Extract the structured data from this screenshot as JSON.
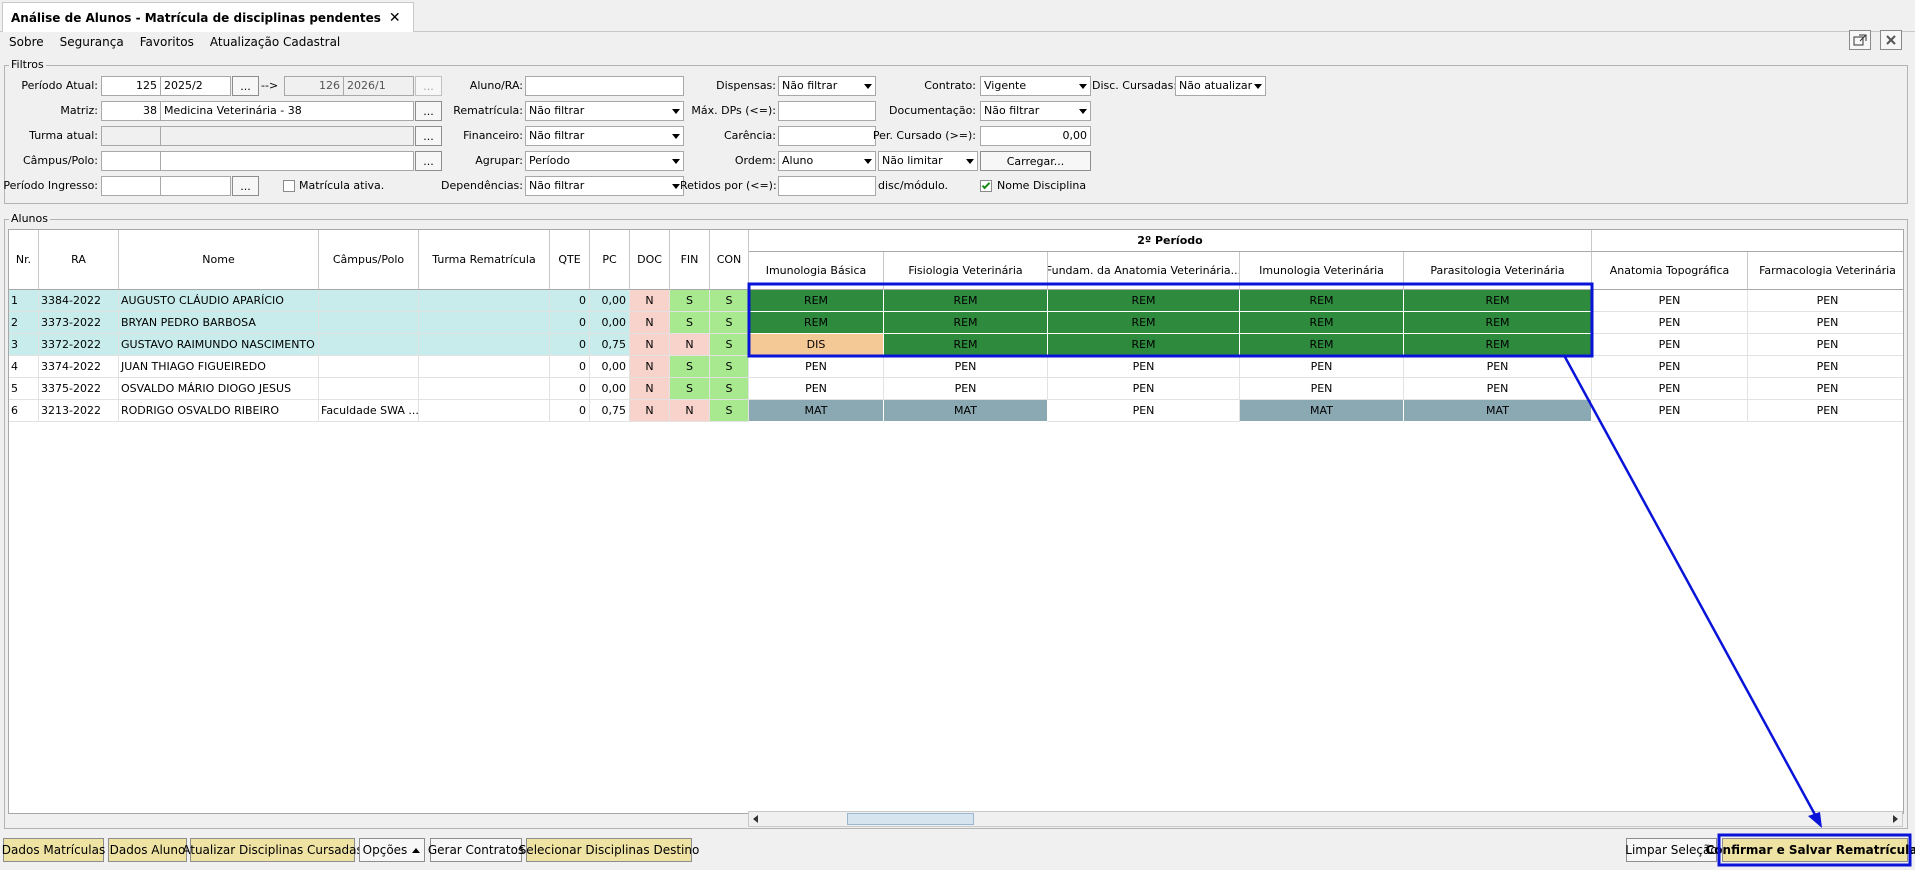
{
  "tab": {
    "title": "Análise de Alunos - Matrícula de disciplinas pendentes",
    "close": "✕"
  },
  "menu": [
    "Sobre",
    "Segurança",
    "Favoritos",
    "Atualização Cadastral"
  ],
  "filters": {
    "legend": "Filtros",
    "periodo_atual": {
      "label": "Período Atual:",
      "code": "125",
      "name": "2025/2",
      "arrow": "-->",
      "to_code": "126",
      "to_name": "2026/1"
    },
    "matriz": {
      "label": "Matriz:",
      "code": "38",
      "name": "Medicina Veterinária - 38"
    },
    "turma_atual": {
      "label": "Turma atual:",
      "code": "",
      "name": ""
    },
    "campus": {
      "label": "Câmpus/Polo:",
      "code": "",
      "name": ""
    },
    "periodo_ingresso": {
      "label": "Período Ingresso:",
      "code": "",
      "name": ""
    },
    "matricula_ativa": {
      "label": "Matrícula ativa.",
      "checked": false
    },
    "aluno_ra": {
      "label": "Aluno/RA:",
      "value": ""
    },
    "rematricula": {
      "label": "Rematrícula:",
      "value": "Não filtrar"
    },
    "financeiro": {
      "label": "Financeiro:",
      "value": "Não filtrar"
    },
    "agrupar": {
      "label": "Agrupar:",
      "value": "Período"
    },
    "dependencias": {
      "label": "Dependências:",
      "value": "Não filtrar"
    },
    "dispensas": {
      "label": "Dispensas:",
      "value": "Não filtrar"
    },
    "max_dps": {
      "label": "Máx. DPs (<=):",
      "value": ""
    },
    "carencia": {
      "label": "Carência:",
      "value": ""
    },
    "ordem": {
      "label": "Ordem:",
      "value": "Aluno",
      "limit": "Não limitar"
    },
    "retidos": {
      "label": "Retidos por (<=):",
      "value": "",
      "suffix": "disc/módulo."
    },
    "contrato": {
      "label": "Contrato:",
      "value": "Vigente"
    },
    "documentacao": {
      "label": "Documentação:",
      "value": "Não filtrar"
    },
    "per_cursado": {
      "label": "Per. Cursado (>=):",
      "value": "0,00"
    },
    "carregar": "Carregar...",
    "nome_disciplina": {
      "label": "Nome Disciplina",
      "checked": true
    },
    "disc_cursadas": {
      "label": "Disc. Cursadas:",
      "value": "Não atualizar"
    },
    "ellipsis": "..."
  },
  "alunos": {
    "legend": "Alunos",
    "group_header": "2º Período",
    "columns": [
      "Nr.",
      "RA",
      "Nome",
      "Câmpus/Polo",
      "Turma Rematrícula",
      "QTE",
      "PC",
      "DOC",
      "FIN",
      "CON"
    ],
    "disciplines": [
      "Imunologia Básica",
      "Fisiologia Veterinária",
      "Fundam. da Anatomia Veterinária...",
      "Imunologia Veterinária",
      "Parasitologia Veterinária",
      "Anatomia Topográfica",
      "Farmacologia Veterinária"
    ],
    "rows": [
      {
        "nr": "1",
        "ra": "3384-2022",
        "nome": "AUGUSTO CLÁUDIO APARÍCIO",
        "campus": "",
        "turma": "",
        "qte": "0",
        "pc": "0,00",
        "doc": "N",
        "fin": "S",
        "con": "S",
        "disc": [
          "REM",
          "REM",
          "REM",
          "REM",
          "REM",
          "PEN",
          "PEN"
        ]
      },
      {
        "nr": "2",
        "ra": "3373-2022",
        "nome": "BRYAN PEDRO BARBOSA",
        "campus": "",
        "turma": "",
        "qte": "0",
        "pc": "0,00",
        "doc": "N",
        "fin": "S",
        "con": "S",
        "disc": [
          "REM",
          "REM",
          "REM",
          "REM",
          "REM",
          "PEN",
          "PEN"
        ]
      },
      {
        "nr": "3",
        "ra": "3372-2022",
        "nome": "GUSTAVO RAIMUNDO NASCIMENTO",
        "campus": "",
        "turma": "",
        "qte": "0",
        "pc": "0,75",
        "doc": "N",
        "fin": "N",
        "con": "S",
        "disc": [
          "DIS",
          "REM",
          "REM",
          "REM",
          "REM",
          "PEN",
          "PEN"
        ]
      },
      {
        "nr": "4",
        "ra": "3374-2022",
        "nome": "JUAN THIAGO FIGUEIREDO",
        "campus": "",
        "turma": "",
        "qte": "0",
        "pc": "0,00",
        "doc": "N",
        "fin": "S",
        "con": "S",
        "disc": [
          "PEN",
          "PEN",
          "PEN",
          "PEN",
          "PEN",
          "PEN",
          "PEN"
        ]
      },
      {
        "nr": "5",
        "ra": "3375-2022",
        "nome": "OSVALDO MÁRIO DIOGO JESUS",
        "campus": "",
        "turma": "",
        "qte": "0",
        "pc": "0,00",
        "doc": "N",
        "fin": "S",
        "con": "S",
        "disc": [
          "PEN",
          "PEN",
          "PEN",
          "PEN",
          "PEN",
          "PEN",
          "PEN"
        ]
      },
      {
        "nr": "6",
        "ra": "3213-2022",
        "nome": "RODRIGO OSVALDO RIBEIRO",
        "campus": "Faculdade SWA ...",
        "turma": "",
        "qte": "0",
        "pc": "0,75",
        "doc": "N",
        "fin": "N",
        "con": "S",
        "disc": [
          "MAT",
          "MAT",
          "PEN",
          "MAT",
          "MAT",
          "PEN",
          "PEN"
        ]
      }
    ]
  },
  "buttons": {
    "dados_matriculas": "Dados Matrículas",
    "dados_aluno": "Dados Aluno",
    "atualizar": "Atualizar Disciplinas Cursadas",
    "opcoes": "Opções",
    "gerar": "Gerar Contratos",
    "selecionar": "Selecionar Disciplinas Destino",
    "limpar": "Limpar Seleção",
    "confirmar": "Confirmar e Salvar Rematrículas"
  },
  "colors": {
    "rem": "#2e8b3e",
    "dis": "#f5c996",
    "mat": "#8ba9b3",
    "selected_row": "#c8ecec",
    "doc_n": "#f7d3cc",
    "fin_s": "#a8e88f",
    "con_s": "#a8e88f",
    "highlight": "#0a14d8",
    "button_yellow": "#efe3a4"
  }
}
